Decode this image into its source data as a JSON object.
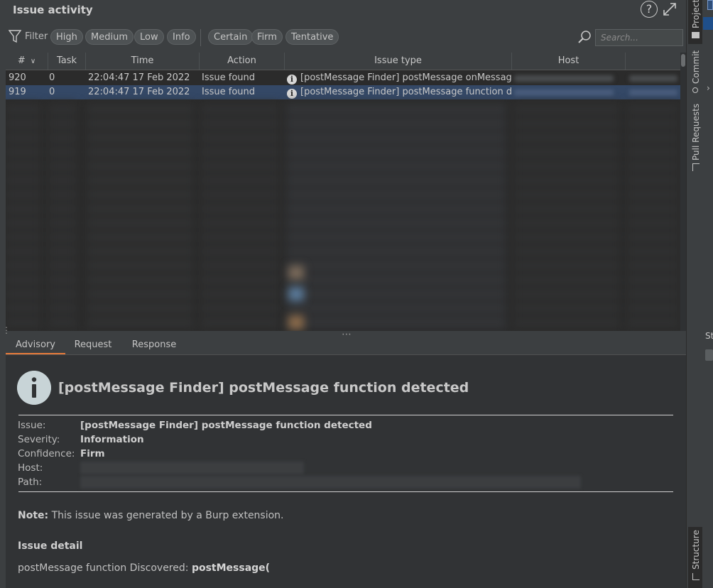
{
  "window": {
    "title": "Issue activity",
    "help_icon": "help-circle-icon",
    "expand_icon": "expand-arrows-icon"
  },
  "filter": {
    "label": "Filter",
    "severity_chips": [
      "High",
      "Medium",
      "Low",
      "Info"
    ],
    "confidence_chips": [
      "Certain",
      "Firm",
      "Tentative"
    ],
    "search_placeholder": "Search..."
  },
  "table": {
    "columns": [
      "#",
      "Task",
      "Time",
      "Action",
      "Issue type",
      "Host"
    ],
    "sort_indicator": "chevron-down-icon",
    "rows": [
      {
        "num": "920",
        "task": "0",
        "time": "22:04:47 17 Feb 2022",
        "action": "Issue found",
        "issue_type": "[postMessage Finder] postMessage onMessage..."
      },
      {
        "num": "919",
        "task": "0",
        "time": "22:04:47 17 Feb 2022",
        "action": "Issue found",
        "issue_type": "[postMessage Finder] postMessage function de...",
        "selected": true
      }
    ]
  },
  "tabs": {
    "items": [
      "Advisory",
      "Request",
      "Response"
    ],
    "active": "Advisory",
    "accent_color": "#e57a3b"
  },
  "advisory": {
    "title": "[postMessage Finder] postMessage function detected",
    "fields": [
      {
        "key": "Issue:",
        "value": "[postMessage Finder] postMessage function detected"
      },
      {
        "key": "Severity:",
        "value": "Information"
      },
      {
        "key": "Confidence:",
        "value": "Firm"
      },
      {
        "key": "Host:",
        "value": ""
      },
      {
        "key": "Path:",
        "value": ""
      }
    ],
    "note_label": "Note:",
    "note_text": " This issue was generated by a Burp extension.",
    "detail_heading": "Issue detail",
    "detail_text": "postMessage function Discovered: ",
    "detail_code": "postMessage("
  },
  "right_stripe": {
    "tabs": [
      "Project",
      "Commit",
      "Pull Requests",
      "Structure"
    ],
    "cut_label": "Str"
  },
  "colors": {
    "panel_bg": "#3c3f41",
    "table_bg": "#2b2b2b",
    "selection": "#344866"
  }
}
